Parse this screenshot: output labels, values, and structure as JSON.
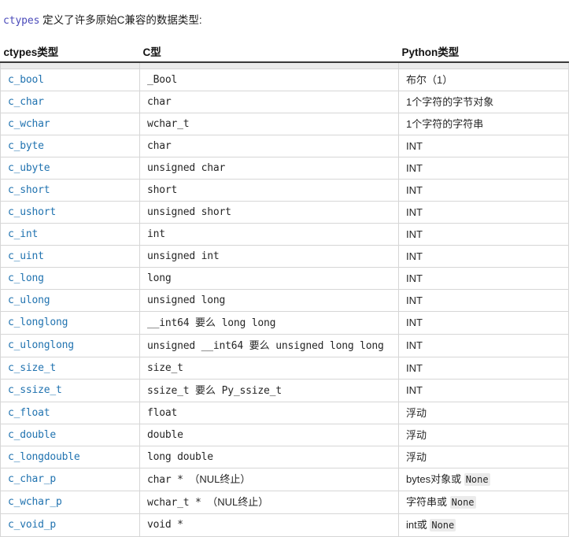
{
  "intro": {
    "code": "ctypes",
    "text": " 定义了许多原始C兼容的数据类型:"
  },
  "table": {
    "headers": {
      "ctypes": "ctypes类型",
      "c": "C型",
      "python": "Python类型"
    },
    "rows": [
      {
        "ctypes": "c_bool",
        "c": "_Bool",
        "c_cjk": "",
        "c_tail": "",
        "python": "布尔（1）",
        "python_code": ""
      },
      {
        "ctypes": "c_char",
        "c": "char",
        "c_cjk": "",
        "c_tail": "",
        "python": "1个字符的字节对象",
        "python_code": ""
      },
      {
        "ctypes": "c_wchar",
        "c": "wchar_t",
        "c_cjk": "",
        "c_tail": "",
        "python": "1个字符的字符串",
        "python_code": ""
      },
      {
        "ctypes": "c_byte",
        "c": "char",
        "c_cjk": "",
        "c_tail": "",
        "python": "INT",
        "python_code": ""
      },
      {
        "ctypes": "c_ubyte",
        "c": "unsigned char",
        "c_cjk": "",
        "c_tail": "",
        "python": "INT",
        "python_code": ""
      },
      {
        "ctypes": "c_short",
        "c": "short",
        "c_cjk": "",
        "c_tail": "",
        "python": "INT",
        "python_code": ""
      },
      {
        "ctypes": "c_ushort",
        "c": "unsigned short",
        "c_cjk": "",
        "c_tail": "",
        "python": "INT",
        "python_code": ""
      },
      {
        "ctypes": "c_int",
        "c": "int",
        "c_cjk": "",
        "c_tail": "",
        "python": "INT",
        "python_code": ""
      },
      {
        "ctypes": "c_uint",
        "c": "unsigned int",
        "c_cjk": "",
        "c_tail": "",
        "python": "INT",
        "python_code": ""
      },
      {
        "ctypes": "c_long",
        "c": "long",
        "c_cjk": "",
        "c_tail": "",
        "python": "INT",
        "python_code": ""
      },
      {
        "ctypes": "c_ulong",
        "c": "unsigned long",
        "c_cjk": "",
        "c_tail": "",
        "python": "INT",
        "python_code": ""
      },
      {
        "ctypes": "c_longlong",
        "c": "__int64 ",
        "c_cjk": "要么",
        "c_tail": " long long",
        "python": "INT",
        "python_code": ""
      },
      {
        "ctypes": "c_ulonglong",
        "c": "unsigned __int64 ",
        "c_cjk": "要么",
        "c_tail": " unsigned long long",
        "python": "INT",
        "python_code": ""
      },
      {
        "ctypes": "c_size_t",
        "c": "size_t",
        "c_cjk": "",
        "c_tail": "",
        "python": "INT",
        "python_code": ""
      },
      {
        "ctypes": "c_ssize_t",
        "c": "ssize_t ",
        "c_cjk": "要么",
        "c_tail": " Py_ssize_t",
        "python": "INT",
        "python_code": ""
      },
      {
        "ctypes": "c_float",
        "c": "float",
        "c_cjk": "",
        "c_tail": "",
        "python": "浮动",
        "python_code": ""
      },
      {
        "ctypes": "c_double",
        "c": "double",
        "c_cjk": "",
        "c_tail": "",
        "python": "浮动",
        "python_code": ""
      },
      {
        "ctypes": "c_longdouble",
        "c": "long double",
        "c_cjk": "",
        "c_tail": "",
        "python": "浮动",
        "python_code": ""
      },
      {
        "ctypes": "c_char_p",
        "c": "char * ",
        "c_cjk": "（NUL终止）",
        "c_tail": "",
        "python": "bytes对象或 ",
        "python_code": "None"
      },
      {
        "ctypes": "c_wchar_p",
        "c": "wchar_t * ",
        "c_cjk": "（NUL终止）",
        "c_tail": "",
        "python": "字符串或 ",
        "python_code": "None"
      },
      {
        "ctypes": "c_void_p",
        "c": "void *",
        "c_cjk": "",
        "c_tail": "",
        "python": "int或 ",
        "python_code": "None"
      }
    ]
  },
  "colors": {
    "link": "#2173b0",
    "code_literal": "#4b4bba",
    "border": "#d6d6d6",
    "header_rule": "#3a3a3a",
    "band": "#ececec",
    "code_bg": "#ebebeb"
  }
}
